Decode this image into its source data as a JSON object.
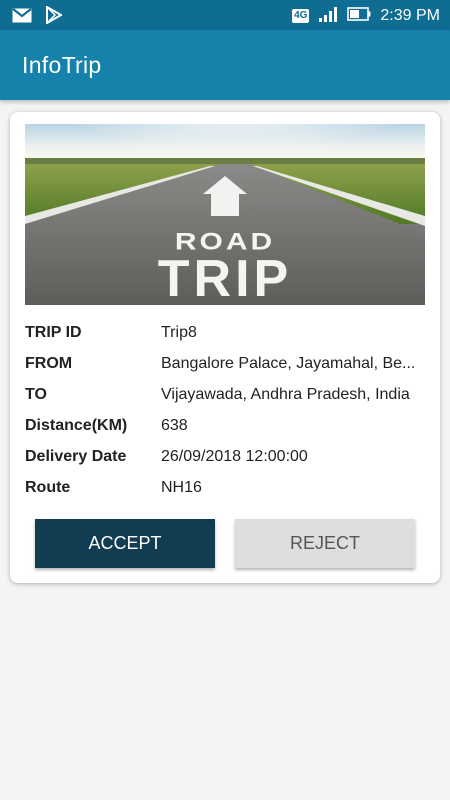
{
  "status_bar": {
    "network_badge": "4G",
    "time": "2:39 PM",
    "icons": [
      "gmail-icon",
      "play-store-icon",
      "signal-icon",
      "battery-icon"
    ]
  },
  "app": {
    "title": "InfoTrip"
  },
  "hero": {
    "text_line1": "ROAD",
    "text_line2": "TRIP"
  },
  "trip": {
    "rows": [
      {
        "label": "TRIP ID",
        "value": "Trip8"
      },
      {
        "label": "FROM",
        "value": "Bangalore Palace, Jayamahal, Be..."
      },
      {
        "label": "TO",
        "value": "Vijayawada, Andhra Pradesh, India"
      },
      {
        "label": "Distance(KM)",
        "value": "638"
      },
      {
        "label": "Delivery Date",
        "value": "26/09/2018 12:00:00"
      },
      {
        "label": "Route",
        "value": "NH16"
      }
    ]
  },
  "actions": {
    "accept_label": "ACCEPT",
    "reject_label": "REJECT"
  },
  "colors": {
    "status_bar": "#0f6d93",
    "app_bar": "#1582ab",
    "accept_bg": "#123c52",
    "reject_bg": "#dedede"
  }
}
